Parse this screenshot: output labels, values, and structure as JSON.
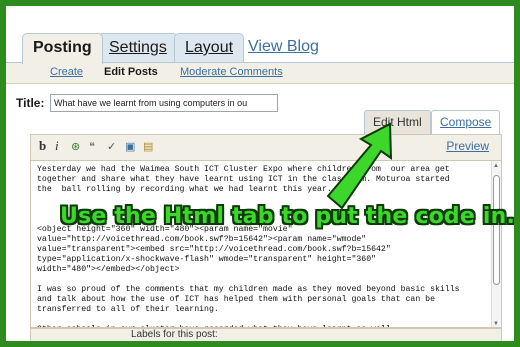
{
  "top_tabs": {
    "posting": "Posting",
    "settings": "Settings",
    "layout": "Layout",
    "view_blog": "View Blog"
  },
  "sub_tabs": {
    "create": "Create",
    "edit_posts": "Edit Posts",
    "moderate": "Moderate Comments"
  },
  "title": {
    "label": "Title:",
    "value": "What have we learnt from using computers in ou"
  },
  "mode_tabs": {
    "edit_html": "Edit Html",
    "compose": "Compose"
  },
  "toolbar": {
    "bold": "b",
    "italic": "i",
    "preview": "Preview"
  },
  "editor": {
    "content": "Yesterday we had the Waimea South ICT Cluster Expo where children from  our area get\ntogether and share what they have learnt using ICT in the classroom. Moturoa started\nthe  ball rolling by recording what we had learnt this year.\n\n\n\n<object height=\"360\" width=\"480\"><param name=\"movie\"\nvalue=\"http://voicethread.com/book.swf?b=15642\"><param name=\"wmode\"\nvalue=\"transparent\"><embed src=\"http://voicethread.com/book.swf?b=15642\"\ntype=\"application/x-shockwave-flash\" wmode=\"transparent\" height=\"360\"\nwidth=\"480\"></embed></object>\n\nI was so proud of the comments that my children made as they moved beyond basic skills\nand talk about how the use of ICT has helped them with personal goals that can be\ntransferred to all of their learning.\n\nOther schools in our cluster have recorded what they have learnt as well."
  },
  "labels_row": {
    "text": "Labels for this post:"
  },
  "annotation": {
    "text": "Use the Html tab to put the code in.",
    "color": "#3dd62a"
  },
  "colors": {
    "frame": "#2e8b1e",
    "link": "#3b6fa0"
  }
}
